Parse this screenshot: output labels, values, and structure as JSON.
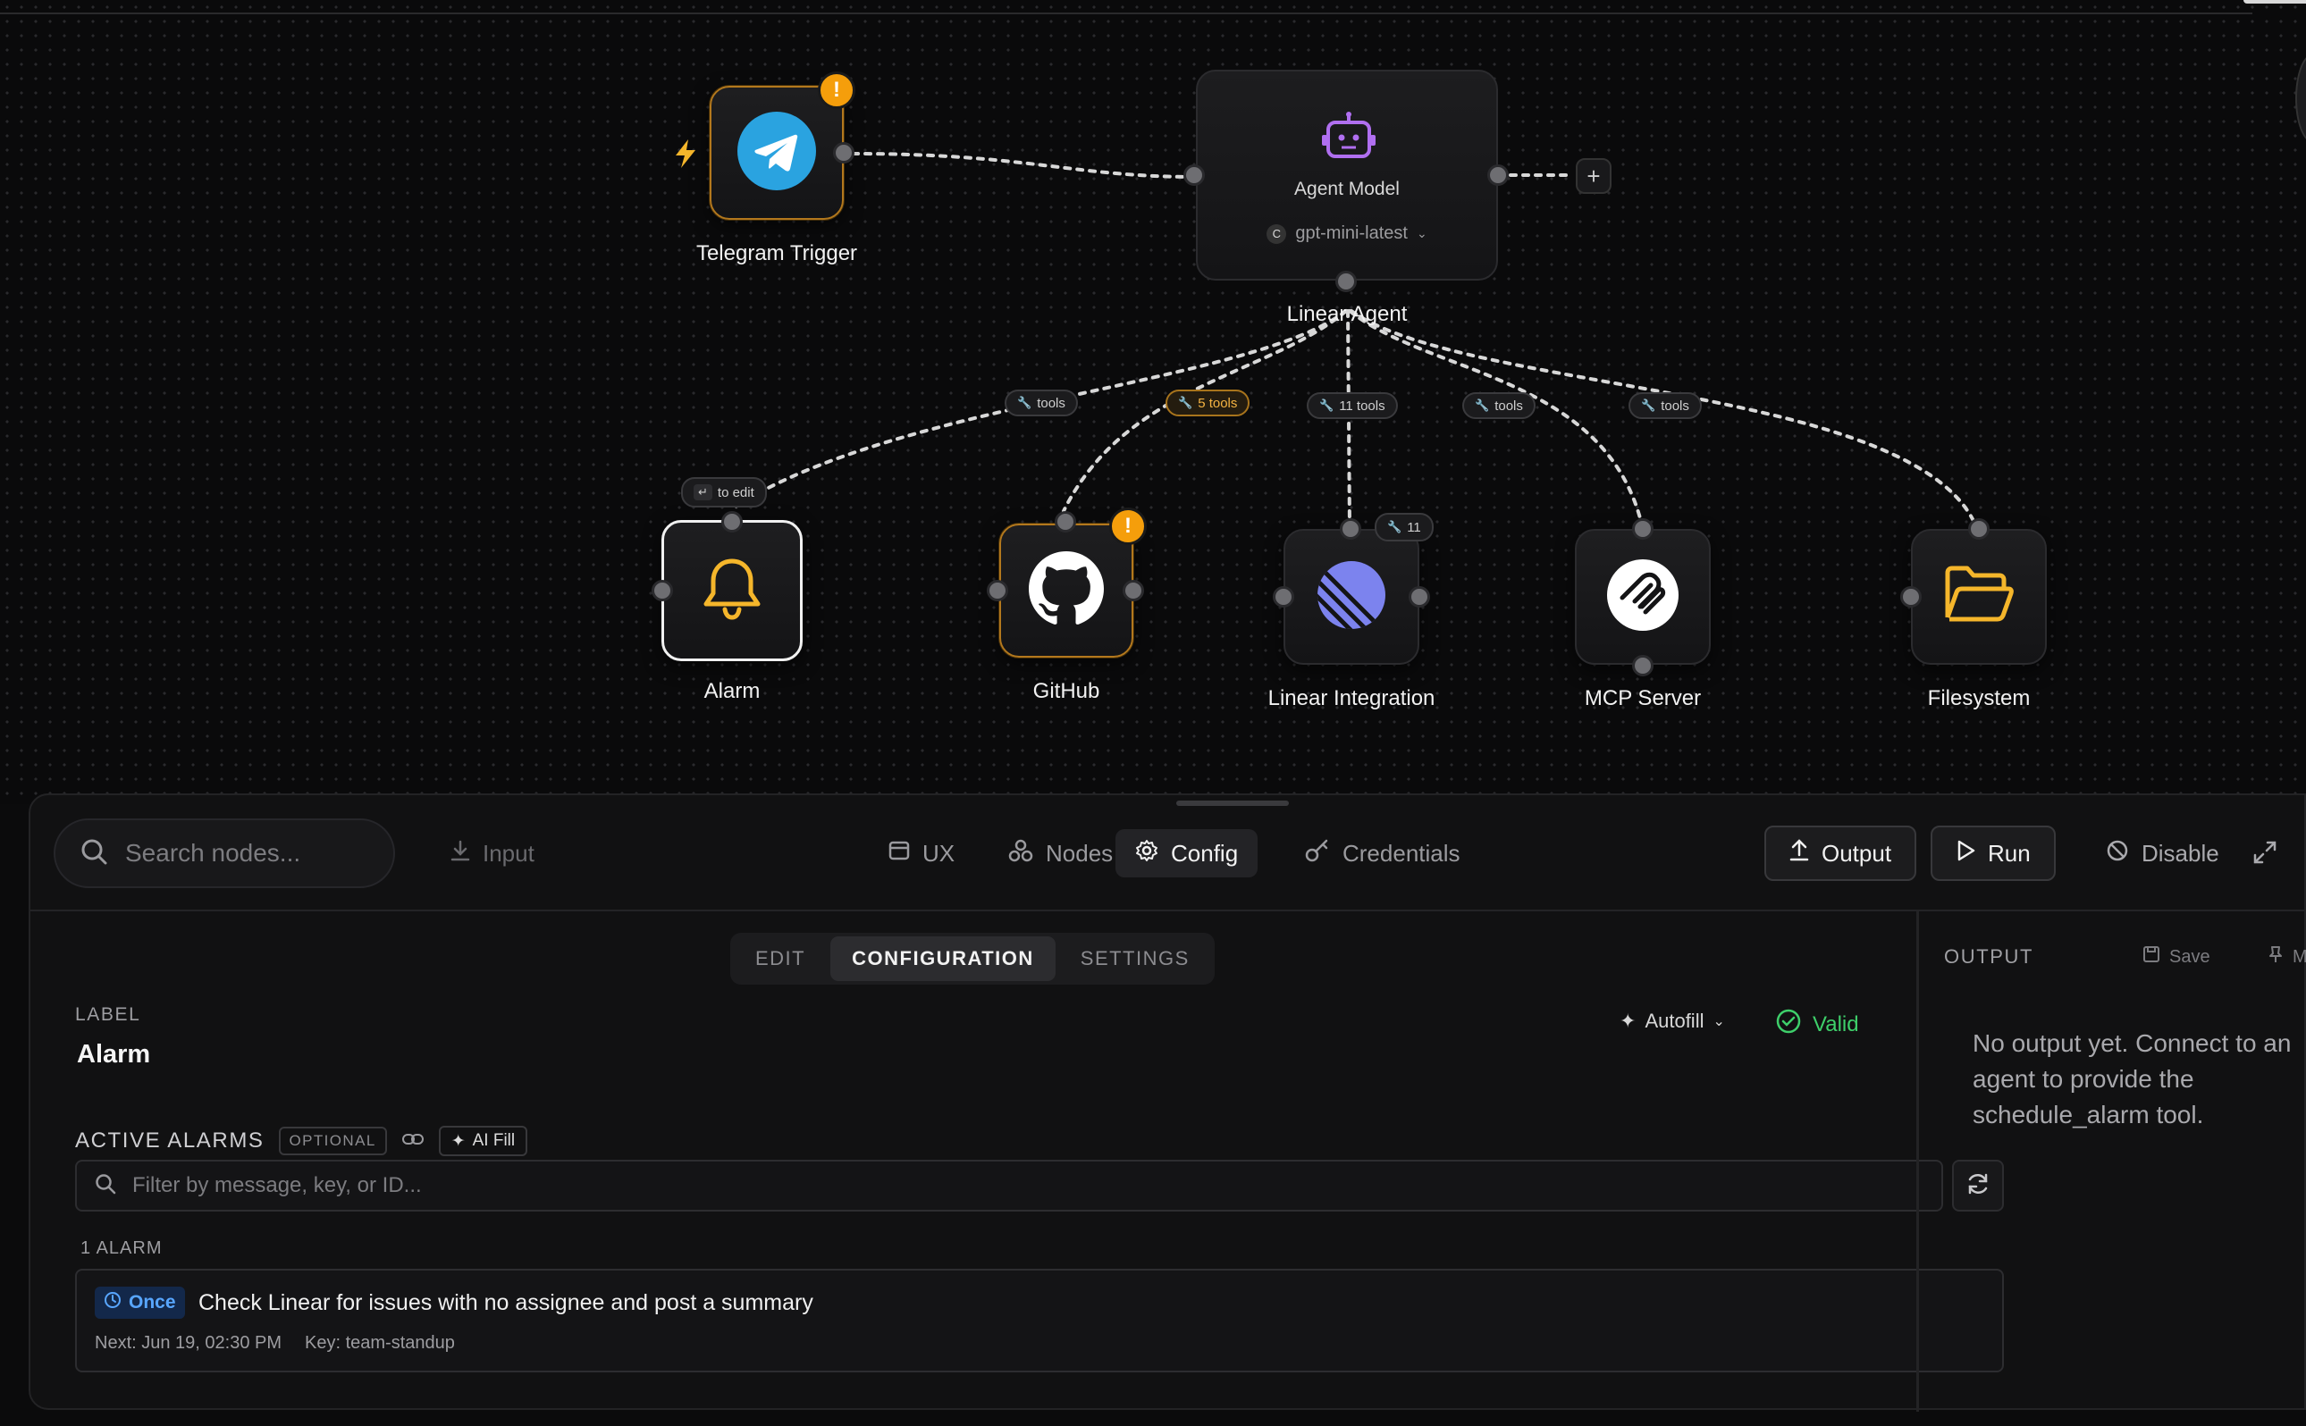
{
  "canvas": {
    "nodes": {
      "telegram": {
        "label": "Telegram Trigger",
        "warning": "!"
      },
      "agent": {
        "title": "Agent Model",
        "model": "gpt-mini-latest",
        "label": "Linear Agent"
      },
      "alarm": {
        "label": "Alarm",
        "hint": "to edit"
      },
      "github": {
        "label": "GitHub",
        "warning": "!"
      },
      "linear": {
        "label": "Linear Integration",
        "tool_count": "11"
      },
      "mcp": {
        "label": "MCP Server"
      },
      "filesystem": {
        "label": "Filesystem"
      }
    },
    "edge_pills": {
      "alarm": "tools",
      "github": "5 tools",
      "linear": "11 tools",
      "mcp": "tools",
      "filesystem": "tools"
    },
    "add_button": "+"
  },
  "toolbar": {
    "search_placeholder": "Search nodes...",
    "input_label": "Input",
    "tabs": {
      "ux": "UX",
      "nodes": "Nodes",
      "config": "Config",
      "credentials": "Credentials"
    },
    "output_button": "Output",
    "run_button": "Run",
    "disable_button": "Disable"
  },
  "config": {
    "subtabs": {
      "edit": "EDIT",
      "configuration": "CONFIGURATION",
      "settings": "SETTINGS"
    },
    "label_heading": "LABEL",
    "label_value": "Alarm",
    "autofill": "Autofill",
    "valid": "Valid",
    "alarms_heading": "ACTIVE ALARMS",
    "optional_tag": "OPTIONAL",
    "ai_fill": "AI Fill",
    "filter_placeholder": "Filter by message, key, or ID...",
    "alarm_count": "1 ALARM",
    "alarm": {
      "frequency": "Once",
      "message": "Check Linear for issues with no assignee and post a summary",
      "next": "Next: Jun 19, 02:30 PM",
      "key": "Key: team-standup"
    }
  },
  "output": {
    "heading": "OUTPUT",
    "save": "Save",
    "more": "Mo",
    "empty_message": "No output yet. Connect to an agent to provide the schedule_alarm tool."
  },
  "colors": {
    "accent_warn": "#f59e0b",
    "valid": "#3ecf6a",
    "once_badge": "#58a6ff"
  }
}
